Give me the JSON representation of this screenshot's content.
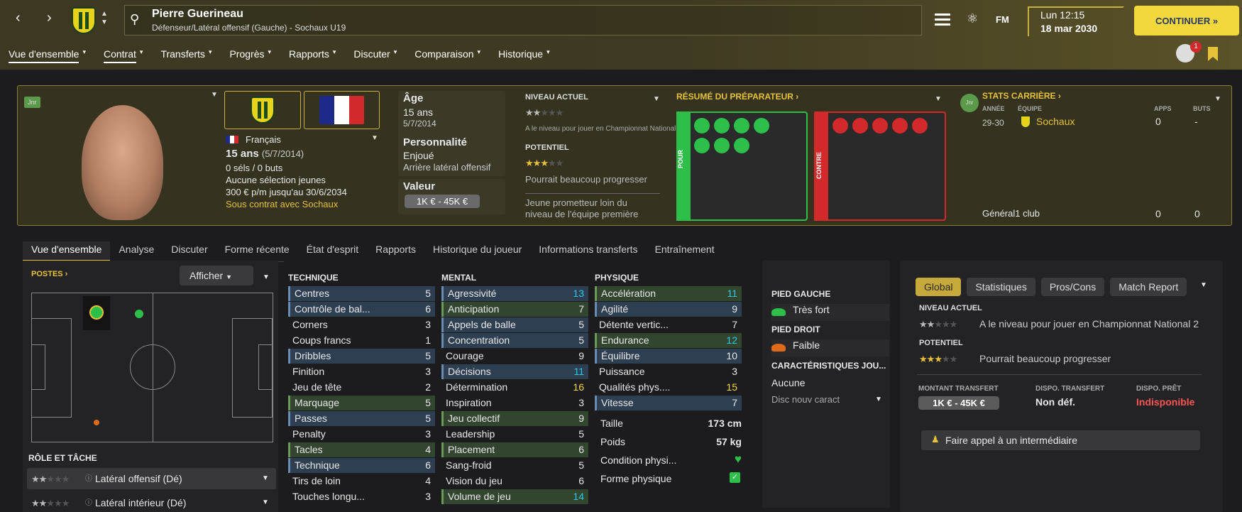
{
  "header": {
    "player_name": "Pierre Guerineau",
    "player_sub": "Défenseur/Latéral offensif (Gauche) - Sochaux U19",
    "time": "Lun 12:15",
    "date": "18 mar 2030",
    "fm": "FM",
    "continue": "CONTINUER »",
    "notif_count": "1"
  },
  "nav": [
    "Vue d'ensemble",
    "Contrat",
    "Transferts",
    "Progrès",
    "Rapports",
    "Discuter",
    "Comparaison",
    "Historique"
  ],
  "profile": {
    "jnr": "Jnr",
    "nationality": "Français",
    "age_line": "15 ans",
    "dob_paren": "(5/7/2014)",
    "caps": "0 séls / 0 buts",
    "youth": "Aucune sélection jeunes",
    "wage": "300 € p/m jusqu'au 30/6/2034",
    "contract": "Sous contrat avec Sochaux"
  },
  "info": {
    "age_label": "Âge",
    "age": "15 ans",
    "dob": "5/7/2014",
    "perso_label": "Personnalité",
    "perso": "Enjoué",
    "role": "Arrière latéral offensif",
    "value_label": "Valeur",
    "value": "1K € - 45K €"
  },
  "level": {
    "current_label": "NIVEAU ACTUEL",
    "current_desc": "A le niveau pour jouer en Championnat National 2",
    "potential_label": "POTENTIEL",
    "potential_desc": "Pourrait beaucoup progresser",
    "note": "Jeune prometteur loin du niveau de l'équipe première",
    "current_stars": 2,
    "potential_stars": 2.5
  },
  "coach": {
    "title": "RÉSUMÉ DU PRÉPARATEUR",
    "pour": "POUR",
    "contre": "CONTRE",
    "pour_color": "#2dbf4a",
    "contre_color": "#d22a2a"
  },
  "career": {
    "title": "STATS CARRIÈRE",
    "col_year": "ANNÉE",
    "col_team": "ÉQUIPE",
    "col_apps": "APPS",
    "col_goals": "BUTS",
    "year": "29-30",
    "team": "Sochaux",
    "apps": "0",
    "goals": "-",
    "total_label": "Général",
    "total_clubs": "1 club",
    "total_apps": "0",
    "total_goals": "0"
  },
  "tabs": [
    "Vue d'ensemble",
    "Analyse",
    "Discuter",
    "Forme récente",
    "État d'esprit",
    "Rapports",
    "Historique du joueur",
    "Informations transferts",
    "Entraînement"
  ],
  "positions": {
    "title": "POSTES",
    "button": "Afficher",
    "role_title": "RÔLE ET TÂCHE",
    "roles": [
      "Latéral offensif (Dé)",
      "Latéral intérieur (Dé)"
    ]
  },
  "technique": {
    "title": "TECHNIQUE",
    "items": [
      [
        "Centres",
        "5"
      ],
      [
        "Contrôle de bal...",
        "6"
      ],
      [
        "Corners",
        "3"
      ],
      [
        "Coups francs",
        "1"
      ],
      [
        "Dribbles",
        "5"
      ],
      [
        "Finition",
        "3"
      ],
      [
        "Jeu de tête",
        "2"
      ],
      [
        "Marquage",
        "5"
      ],
      [
        "Passes",
        "5"
      ],
      [
        "Penalty",
        "3"
      ],
      [
        "Tacles",
        "4"
      ],
      [
        "Technique",
        "6"
      ],
      [
        "Tirs de loin",
        "4"
      ],
      [
        "Touches longu...",
        "3"
      ]
    ]
  },
  "mental": {
    "title": "MENTAL",
    "items": [
      [
        "Agressivité",
        "13"
      ],
      [
        "Anticipation",
        "7"
      ],
      [
        "Appels de balle",
        "5"
      ],
      [
        "Concentration",
        "5"
      ],
      [
        "Courage",
        "9"
      ],
      [
        "Décisions",
        "11"
      ],
      [
        "Détermination",
        "16"
      ],
      [
        "Inspiration",
        "3"
      ],
      [
        "Jeu collectif",
        "9"
      ],
      [
        "Leadership",
        "5"
      ],
      [
        "Placement",
        "6"
      ],
      [
        "Sang-froid",
        "5"
      ],
      [
        "Vision du jeu",
        "6"
      ],
      [
        "Volume de jeu",
        "14"
      ]
    ]
  },
  "physique": {
    "title": "PHYSIQUE",
    "items": [
      [
        "Accélération",
        "11"
      ],
      [
        "Agilité",
        "9"
      ],
      [
        "Détente vertic...",
        "7"
      ],
      [
        "Endurance",
        "12"
      ],
      [
        "Équilibre",
        "10"
      ],
      [
        "Puissance",
        "3"
      ],
      [
        "Qualités phys....",
        "15"
      ],
      [
        "Vitesse",
        "7"
      ]
    ],
    "height_label": "Taille",
    "height": "173 cm",
    "weight_label": "Poids",
    "weight": "57 kg",
    "cond_label": "Condition physi...",
    "form_label": "Forme physique"
  },
  "feet": {
    "left_label": "PIED GAUCHE",
    "left": "Très fort",
    "right_label": "PIED DROIT",
    "right": "Faible",
    "traits_label": "CARACTÉRISTIQUES JOU...",
    "traits": "Aucune",
    "traits_select": "Disc nouv caract"
  },
  "right": {
    "tabs": [
      "Global",
      "Statistiques",
      "Pros/Cons",
      "Match Report"
    ],
    "current_label": "NIVEAU ACTUEL",
    "current_desc": "A le niveau pour jouer en Championnat National 2",
    "potential_label": "POTENTIEL",
    "potential_desc": "Pourrait beaucoup progresser",
    "transfer_label": "MONTANT TRANSFERT",
    "transfer": "1K € - 45K €",
    "dispo_t_label": "DISPO. TRANSFERT",
    "dispo_t": "Non déf.",
    "dispo_p_label": "DISPO. PRÊT",
    "dispo_p": "Indisponible",
    "agent": "Faire appel à un intermédiaire"
  }
}
